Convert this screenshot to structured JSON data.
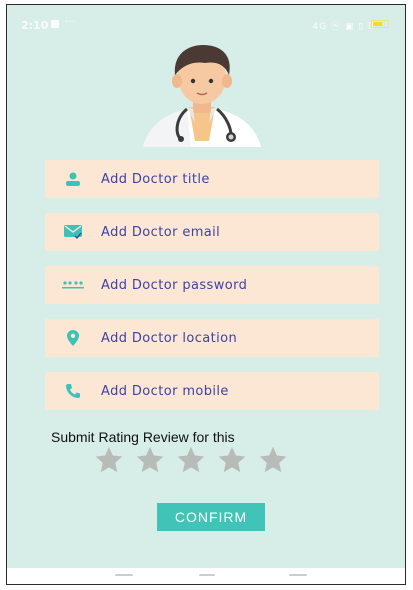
{
  "status_bar": {
    "time": "2:10",
    "more": "···",
    "right_indicators": "4G ⓦ ▣ ▯ ll"
  },
  "form": {
    "fields": [
      {
        "label": "Add Doctor title",
        "icon": "person-icon"
      },
      {
        "label": "Add Doctor email",
        "icon": "email-icon"
      },
      {
        "label": "Add Doctor password",
        "icon": "password-dots-icon"
      },
      {
        "label": "Add Doctor location",
        "icon": "location-pin-icon"
      },
      {
        "label": "Add Doctor mobile",
        "icon": "phone-icon"
      }
    ]
  },
  "rating": {
    "title": "Submit Rating Review for this",
    "stars_total": 5,
    "stars_filled": 0
  },
  "confirm_label": "CONFIRM",
  "colors": {
    "background": "#d6ede8",
    "field_bg": "#fbe7d3",
    "field_text": "#3f42a5",
    "icon": "#3cc2b7",
    "confirm_bg": "#40c4b8",
    "star": "#b8bcb9"
  }
}
